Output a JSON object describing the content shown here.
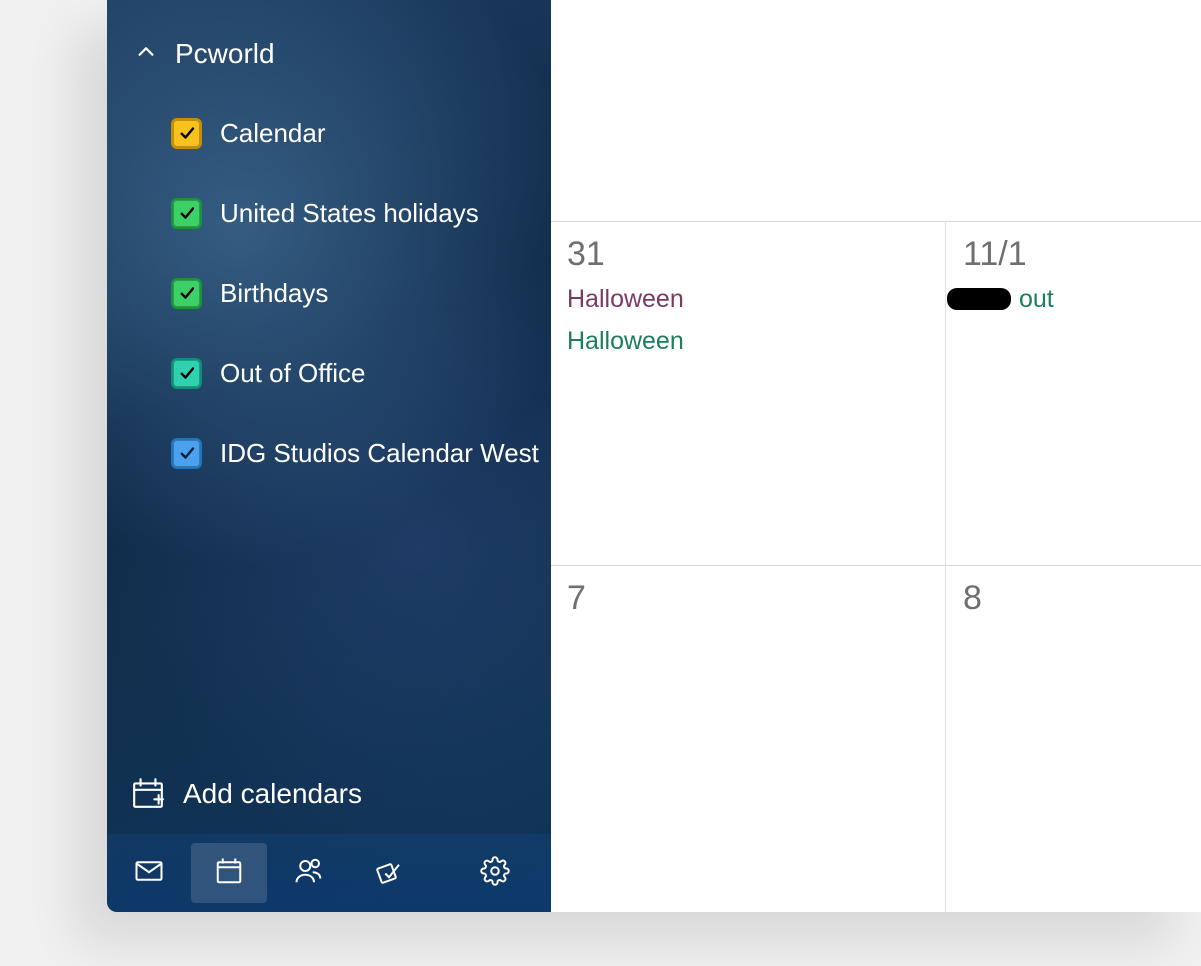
{
  "sidebar": {
    "group_label": "Pcworld",
    "calendars": [
      {
        "label": "Calendar",
        "color": "#f8c21c",
        "outline": "#c58f00",
        "check": "#000"
      },
      {
        "label": "United States holidays",
        "color": "#3dd067",
        "outline": "#18933b",
        "check": "#000"
      },
      {
        "label": "Birthdays",
        "color": "#3dd067",
        "outline": "#18933b",
        "check": "#000"
      },
      {
        "label": "Out of Office",
        "color": "#2ed2b0",
        "outline": "#0e8e78",
        "check": "#000"
      },
      {
        "label": "IDG Studios Calendar West",
        "color": "#4aa2ef",
        "outline": "#1e74bd",
        "check": "#07203c"
      }
    ],
    "add_label": "Add calendars"
  },
  "grid": {
    "days": {
      "d31": {
        "label": "31"
      },
      "d11_1": {
        "label": "11/1"
      },
      "d7": {
        "label": "7"
      },
      "d8": {
        "label": "8"
      }
    },
    "events": {
      "d31_e1": "Halloween",
      "d31_e2": "Halloween",
      "d11_1_e1_suffix": "out"
    }
  }
}
